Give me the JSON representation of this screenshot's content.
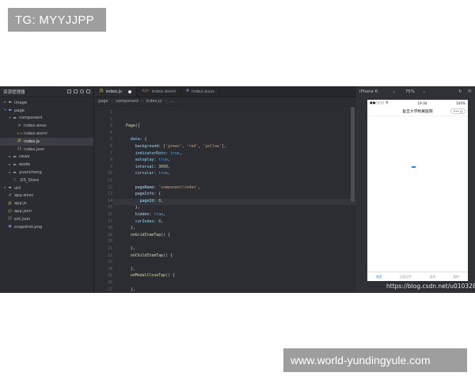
{
  "watermark_top": "TG: MYYJJPP",
  "watermark_bottom": "www.world-yundingyule.com",
  "sidebar": {
    "title": "资源管理器",
    "tree": [
      {
        "label": "image",
        "icon": "folder-icon",
        "arrow": "▸",
        "level": 1
      },
      {
        "label": "page",
        "icon": "folder-icon",
        "arrow": "▾",
        "level": 1
      },
      {
        "label": "component",
        "icon": "folder-icon",
        "arrow": "▾",
        "level": 2
      },
      {
        "label": "index.wxss",
        "icon": "wxss-file-icon",
        "arrow": "",
        "level": 3
      },
      {
        "label": "index.wxml",
        "icon": "wxml-file-icon",
        "arrow": "",
        "level": 3
      },
      {
        "label": "index.js",
        "icon": "js-file-icon",
        "arrow": "",
        "level": 3,
        "selected": true
      },
      {
        "label": "index.json",
        "icon": "json-file-icon",
        "arrow": "",
        "level": 3
      },
      {
        "label": "news",
        "icon": "folder-icon",
        "arrow": "▸",
        "level": 2
      },
      {
        "label": "wode",
        "icon": "folder-icon",
        "arrow": "▸",
        "level": 2
      },
      {
        "label": "yuancheng",
        "icon": "folder-icon",
        "arrow": "▸",
        "level": 2
      },
      {
        "label": ".DS_Store",
        "icon": "ds-store-icon",
        "arrow": "",
        "level": 2
      },
      {
        "label": "util",
        "icon": "folder-icon",
        "arrow": "▸",
        "level": 1
      },
      {
        "label": "app.wxss",
        "icon": "wxss-file-icon",
        "arrow": "",
        "level": 1
      },
      {
        "label": "app.js",
        "icon": "js-file-icon",
        "arrow": "",
        "level": 1
      },
      {
        "label": "app.json",
        "icon": "json-file-icon",
        "arrow": "",
        "level": 1
      },
      {
        "label": "ext.json",
        "icon": "json-file-icon",
        "arrow": "",
        "level": 1
      },
      {
        "label": "snapshot.png",
        "icon": "png-file-icon",
        "arrow": "",
        "level": 1
      }
    ]
  },
  "editor": {
    "tabs": [
      {
        "label": "index.js",
        "icon": "JS",
        "active": true,
        "modified": true
      },
      {
        "label": "index.wxml",
        "icon": "</>",
        "active": false
      },
      {
        "label": "index.wxss",
        "icon": "#",
        "active": false
      }
    ],
    "breadcrumb": [
      "page",
      "component",
      "index.js",
      "..."
    ],
    "current_line": 14,
    "lines": [
      "",
      "",
      "Page({",
      "",
      "  data: {",
      "    background: ['green', 'red', 'yellow'],",
      "    indicatorDots: true,",
      "    autoplay: true,",
      "    interval: 3000,",
      "    circular: true,",
      "",
      "    pageName: 'component/index',",
      "    pageInfo: {",
      "      pageId: 0,",
      "    },",
      "    hidden: true,",
      "    curIndex: 0,",
      "  },",
      "  onGridItemTap() {",
      "",
      "  },",
      "  onChildItemTap() {",
      "",
      "  },",
      "  onModalCloseTap() {",
      "",
      "  },",
      "    changeIndicatorDots(e) {",
      "    this.setData({",
      "      indicatorDots: !this.data.indicatorDots",
      "    })",
      "  },"
    ]
  },
  "simulator": {
    "device": "iPhone 6",
    "zoom": "75%",
    "status_left": "●●○○○ 令",
    "status_time": "19:34",
    "status_right": "100%",
    "nav_title": "复旦大学附属医院",
    "capsule": "••• ◎",
    "tabbar": [
      "首页",
      "远程诊疗",
      "消息",
      "我的"
    ]
  },
  "url_watermark": "https://blog.csdn.net/u010328533"
}
